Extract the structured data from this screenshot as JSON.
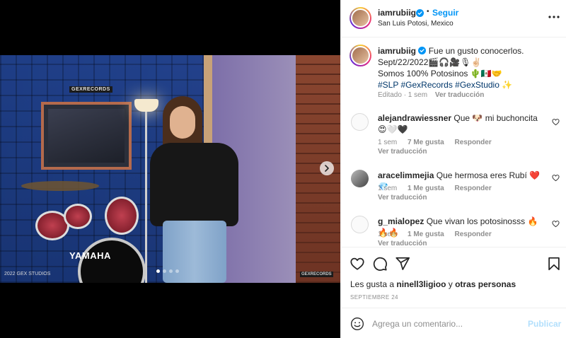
{
  "colors": {
    "accent": "#0095f6",
    "text": "#262626",
    "muted": "#8e8e8e",
    "link": "#00376b",
    "publish_disabled": "#b2dffc"
  },
  "media": {
    "watermark_top": "GEXRECORDS",
    "drum_logo": "YAMAHA",
    "caption_left": "2022 GEX STUDIOS",
    "caption_right": "GEXRECORDS",
    "carousel": {
      "slides": 4,
      "active": 0
    },
    "next_icon": "chevron-right-icon"
  },
  "header": {
    "username": "iamrubiig",
    "separator": "•",
    "follow_label": "Seguir",
    "location": "San Luis Potosi, Mexico",
    "more_icon": "more-horizontal-icon"
  },
  "caption": {
    "username": "iamrubiig",
    "text_line1": "Fue un gusto conocerlos.",
    "text_line2": "Sept/22/2022🎬🎧🎥🎙✌🏻",
    "text_line3": "Somos 100% Potosinos 🌵🇲🇽🤝",
    "hashtags": "#SLP #GexRecords #GexStudio ✨",
    "edited": "Editado · 1 sem",
    "translate": "Ver traducción"
  },
  "comments": [
    {
      "username": "alejandrawiessner",
      "text": "Que 🐶 mi buchoncita 😍🤍🖤",
      "time": "1 sem",
      "likes": "7 Me gusta",
      "reply": "Responder",
      "translate": "Ver traducción"
    },
    {
      "username": "aracelimmejia",
      "text": "Que hermosa eres Rubí ❤️💎",
      "time": "1 sem",
      "likes": "1 Me gusta",
      "reply": "Responder",
      "translate": "Ver traducción"
    },
    {
      "username": "g_mialopez",
      "text": "Que vivan los potosinosss 🔥🔥🔥",
      "time": "1 sem",
      "likes": "1 Me gusta",
      "reply": "Responder",
      "translate": "Ver traducción"
    }
  ],
  "actions": {
    "likes_prefix": "Les gusta a",
    "liker": "ninell3ligioo",
    "likes_joiner": "y",
    "likes_suffix": "otras personas",
    "date": "SEPTIEMBRE 24"
  },
  "composer": {
    "placeholder": "Agrega un comentario...",
    "publish_label": "Publicar"
  }
}
